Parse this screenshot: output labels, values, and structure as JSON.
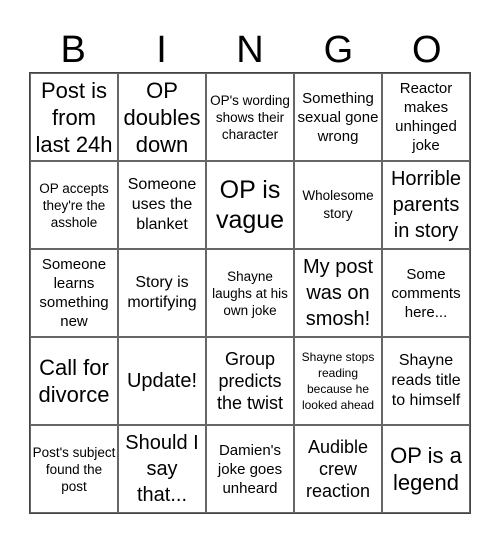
{
  "title": [
    "B",
    "I",
    "N",
    "G",
    "O"
  ],
  "cells": [
    [
      "Post is from last 24h",
      "OP doubles down",
      "OP's wording shows their character",
      "Something sexual gone wrong",
      "Reactor makes unhinged joke"
    ],
    [
      "OP accepts they're the asshole",
      "Someone uses the blanket",
      "OP is vague",
      "Wholesome story",
      "Horrible parents in story"
    ],
    [
      "Someone learns something new",
      "Story is mortifying",
      "Shayne laughs at his own joke",
      "My post was on smosh!",
      "Some comments here..."
    ],
    [
      "Call for divorce",
      "Update!",
      "Group predicts the twist",
      "Shayne stops reading because he looked ahead",
      "Shayne reads title to himself"
    ],
    [
      "Post's subject found the post",
      "Should I say that...",
      "Damien's joke goes unheard",
      "Audible crew reaction",
      "OP is a legend"
    ]
  ]
}
